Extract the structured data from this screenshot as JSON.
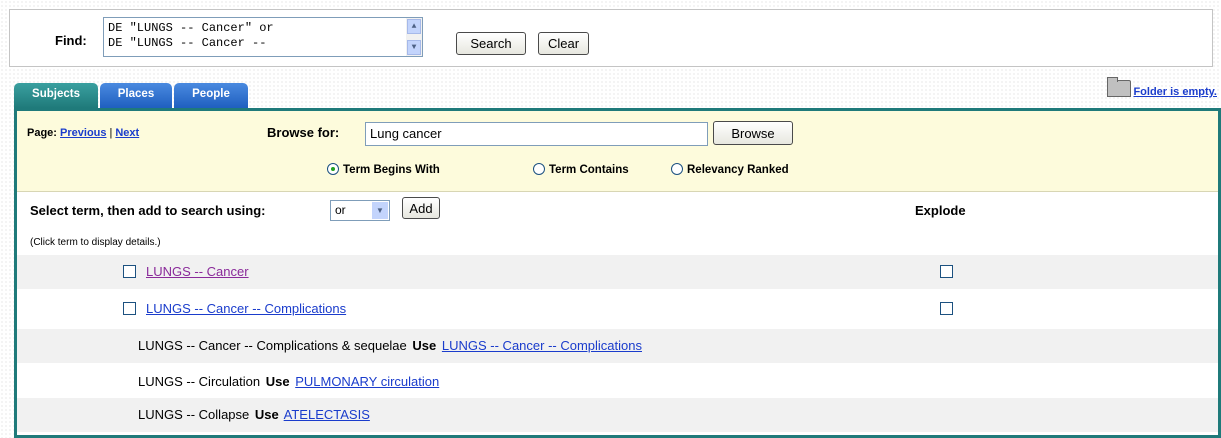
{
  "find": {
    "label": "Find:",
    "query_line1": "DE \"LUNGS -- Cancer\" or",
    "query_line2": "DE \"LUNGS -- Cancer --",
    "search_label": "Search",
    "clear_label": "Clear"
  },
  "tabs": [
    {
      "label": "Subjects",
      "active": true
    },
    {
      "label": "Places",
      "active": false
    },
    {
      "label": "People",
      "active": false
    }
  ],
  "folder": {
    "label": "Folder is empty."
  },
  "browse": {
    "page_label": "Page:",
    "previous_label": "Previous",
    "separator": "|",
    "next_label": "Next",
    "browse_for_label": "Browse for:",
    "browse_value": "Lung cancer",
    "browse_button": "Browse",
    "radio_options": [
      {
        "label": "Term Begins With",
        "selected": true
      },
      {
        "label": "Term Contains",
        "selected": false
      },
      {
        "label": "Relevancy Ranked",
        "selected": false
      }
    ]
  },
  "select": {
    "label": "Select term, then add to search using:",
    "operator": "or",
    "add_label": "Add",
    "explode_label": "Explode",
    "hint": "(Click term to display details.)"
  },
  "terms": [
    {
      "label": "LUNGS -- Cancer",
      "visited": true
    },
    {
      "label": "LUNGS -- Cancer -- Complications",
      "visited": false
    }
  ],
  "references": [
    {
      "term": "LUNGS -- Cancer -- Complications & sequelae",
      "use_label": "Use",
      "target": "LUNGS -- Cancer -- Complications"
    },
    {
      "term": "LUNGS -- Circulation",
      "use_label": "Use",
      "target": "PULMONARY circulation"
    },
    {
      "term": "LUNGS -- Collapse",
      "use_label": "Use",
      "target": "ATELECTASIS"
    }
  ],
  "colors": {
    "panel_border": "#1f7a7a",
    "active_tab": "#1f7a7a",
    "inactive_tab": "#1f5fbf",
    "link": "#1a3ccc",
    "visited_link": "#8a2a9a",
    "browse_background": "#fdfbdc"
  }
}
